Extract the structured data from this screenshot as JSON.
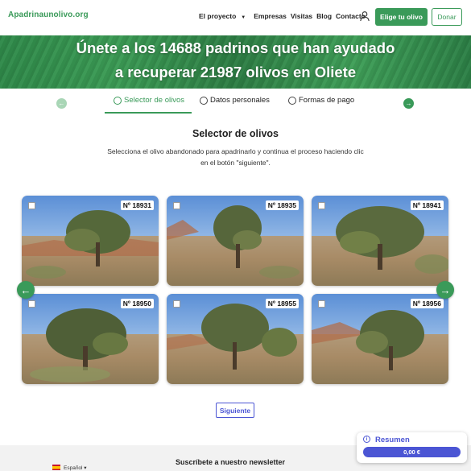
{
  "header": {
    "logo": "Apadrinaunolivo.org",
    "nav": [
      {
        "label": "El proyecto",
        "has_dropdown": true
      },
      {
        "label": "Empresas"
      },
      {
        "label": "Visitas"
      },
      {
        "label": "Blog"
      },
      {
        "label": "Contacto"
      }
    ],
    "user_icon": "user-icon",
    "cta_primary": "Elige tu olivo",
    "cta_secondary": "Donar"
  },
  "banner": {
    "line1": "Únete a los 14688 padrinos que han ayudado",
    "line2": "a recuperar 21987 olivos en Oliete"
  },
  "steps": [
    {
      "label": "Selector de olivos",
      "active": true
    },
    {
      "label": "Datos personales",
      "active": false
    },
    {
      "label": "Formas de pago",
      "active": false
    }
  ],
  "selector": {
    "title": "Selector de olivos",
    "description": "Selecciona el olivo abandonado para apadrinarlo y continua el proceso haciendo clic en el botón \"siguiente\"."
  },
  "trees": [
    {
      "number": "Nº 18931"
    },
    {
      "number": "Nº 18935"
    },
    {
      "number": "Nº 18941"
    },
    {
      "number": "Nº 18950"
    },
    {
      "number": "Nº 18955"
    },
    {
      "number": "Nº 18956"
    }
  ],
  "next_button": "Siguiente",
  "footer": {
    "language": "Español",
    "newsletter": "Suscríbete a nuestro newsletter"
  },
  "summary": {
    "label": "Resumen",
    "amount": "0,00 €"
  },
  "colors": {
    "brand_green": "#3a9a59",
    "accent_blue": "#4b55d4"
  }
}
